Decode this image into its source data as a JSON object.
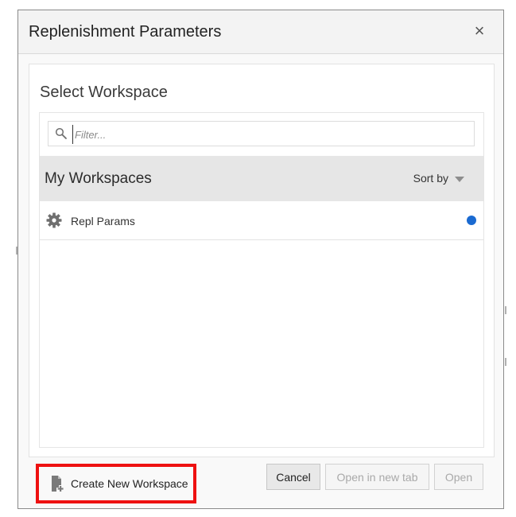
{
  "dialog": {
    "title": "Replenishment Parameters",
    "close_glyph": "×",
    "close_icon": "close-icon"
  },
  "panel": {
    "heading": "Select Workspace",
    "filter": {
      "placeholder": "Filter...",
      "value": "",
      "icon": "search-icon"
    },
    "group": {
      "title": "My Workspaces",
      "sort_label": "Sort by",
      "sort_icon": "caret-down-icon"
    },
    "workspaces": [
      {
        "label": "Repl Params",
        "icon": "gear-icon",
        "status_color": "#1a6ad1"
      }
    ]
  },
  "footer": {
    "create_label": "Create New Workspace",
    "create_icon": "new-file-icon",
    "cancel_label": "Cancel",
    "open_new_tab_label": "Open in new tab",
    "open_label": "Open"
  },
  "colors": {
    "highlight_border": "#ee1111",
    "status_dot": "#1a6ad1",
    "group_header_bg": "#e6e6e6"
  }
}
